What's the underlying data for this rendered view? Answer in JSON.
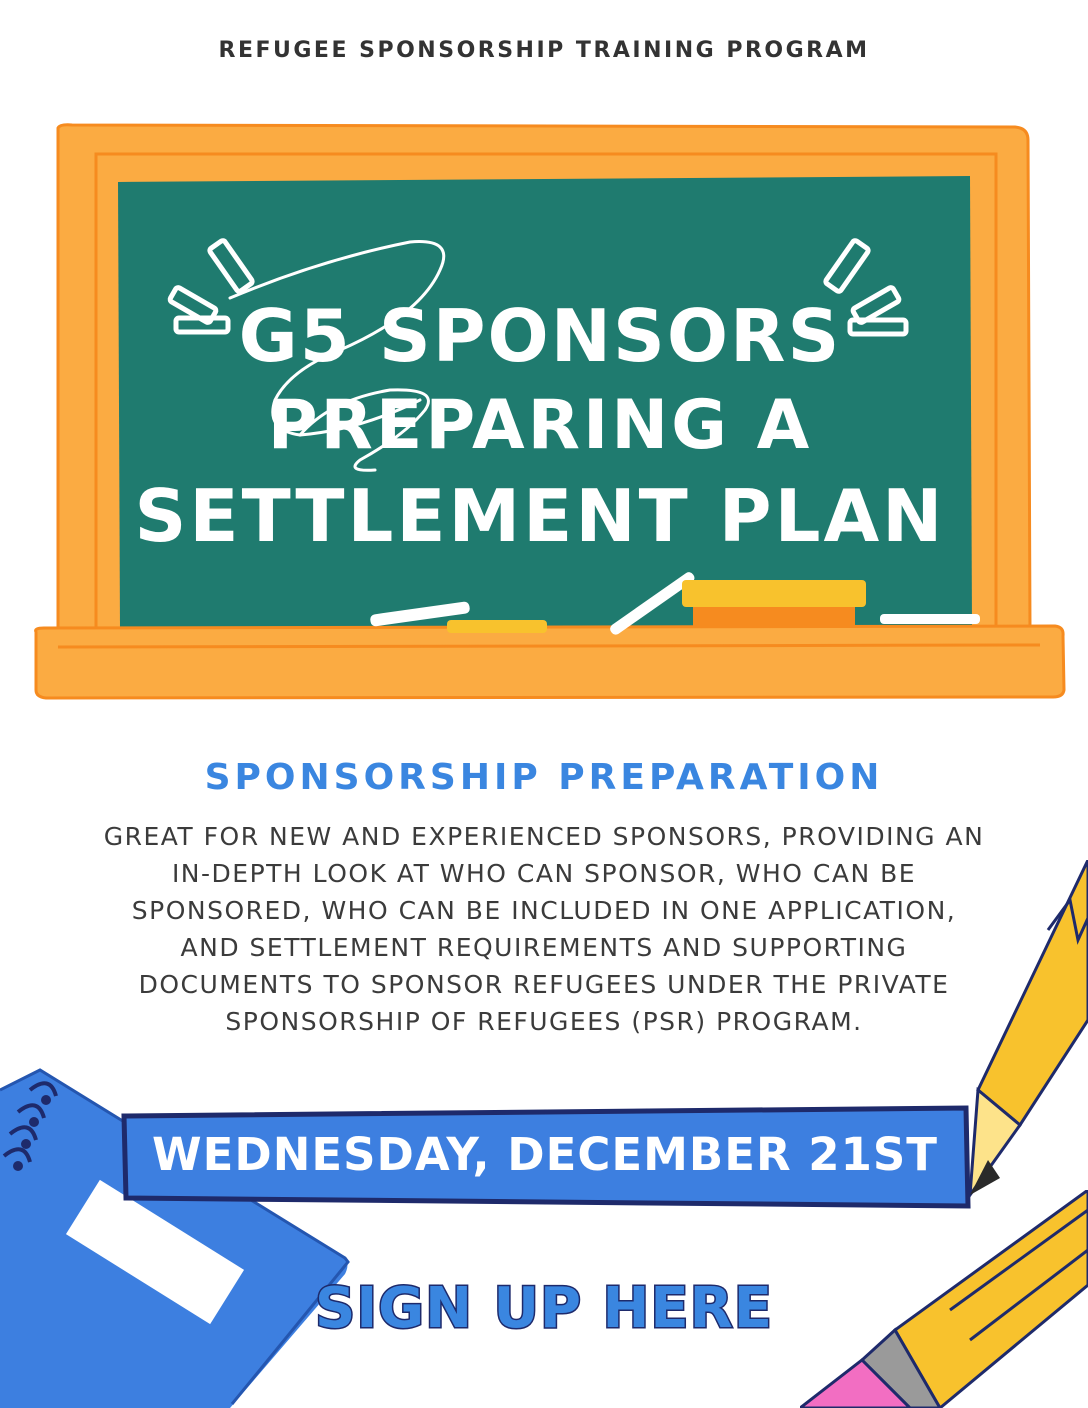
{
  "header": {
    "program_label": "REFUGEE SPONSORSHIP TRAINING PROGRAM"
  },
  "chalkboard": {
    "title_line1": "G5 SPONSORS",
    "title_line2": "PREPARING A",
    "title_line3": "SETTLEMENT PLAN"
  },
  "section": {
    "heading": "SPONSORSHIP PREPARATION",
    "description": "GREAT FOR NEW AND EXPERIENCED SPONSORS, PROVIDING AN IN-DEPTH LOOK AT WHO CAN SPONSOR, WHO CAN BE SPONSORED, WHO CAN BE INCLUDED IN ONE APPLICATION, AND SETTLEMENT REQUIREMENTS AND SUPPORTING DOCUMENTS TO SPONSOR REFUGEES UNDER THE PRIVATE SPONSORSHIP OF REFUGEES (PSR) PROGRAM."
  },
  "event": {
    "date": "WEDNESDAY, DECEMBER 21ST"
  },
  "cta": {
    "signup_label": "SIGN UP HERE"
  },
  "colors": {
    "board_green": "#1f7b6f",
    "frame_orange": "#fbab42",
    "accent_blue": "#3a86e0",
    "navy_outline": "#1e2a6b",
    "pencil_yellow": "#f8c22d",
    "eraser_pink": "#f26ec2"
  },
  "icons": [
    "chalkboard-illustration",
    "chalk-stick",
    "chalk-eraser",
    "spiral-notebook-icon",
    "pencil-icon"
  ]
}
